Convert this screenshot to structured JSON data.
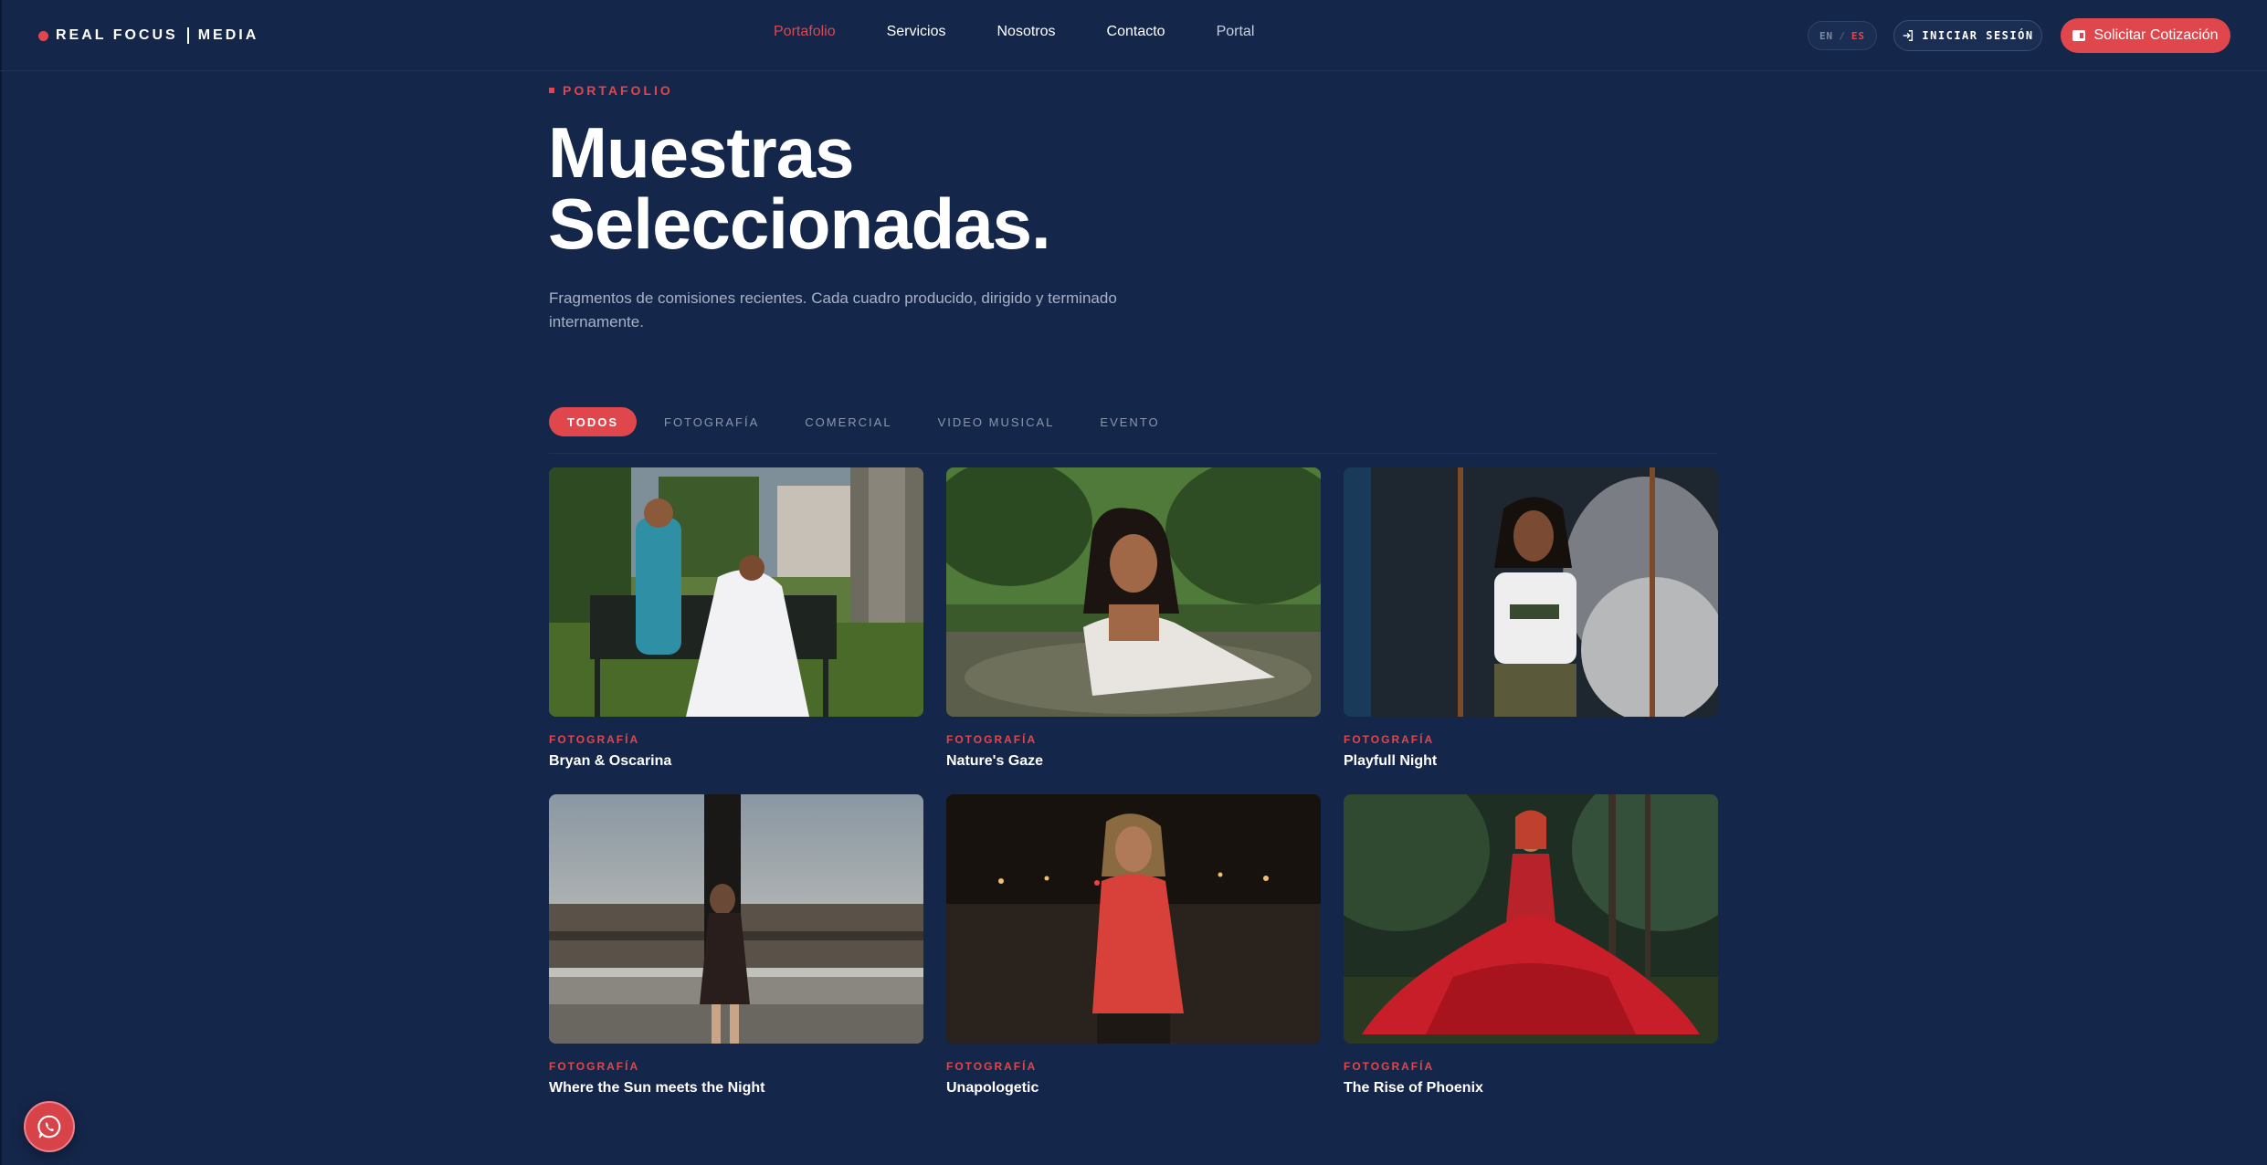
{
  "brand": {
    "name_left": "REAL FOCUS",
    "name_right": "MEDIA",
    "accent": "#e0474c",
    "background": "#14264a"
  },
  "nav": {
    "items": [
      {
        "label": "Portafolio",
        "state": "active"
      },
      {
        "label": "Servicios",
        "state": "default"
      },
      {
        "label": "Nosotros",
        "state": "default"
      },
      {
        "label": "Contacto",
        "state": "default"
      },
      {
        "label": "Portal",
        "state": "muted"
      }
    ],
    "lang": {
      "en": "EN",
      "sep": "/",
      "es": "ES",
      "selected": "ES"
    },
    "login_label": "INICIAR SESIÓN",
    "quote_label": "Solicitar Cotización"
  },
  "hero": {
    "eyebrow": "PORTAFOLIO",
    "title_line1": "Muestras",
    "title_line2": "Seleccionadas.",
    "subtitle": "Fragmentos de comisiones recientes. Cada cuadro producido, dirigido y terminado internamente."
  },
  "filters": {
    "items": [
      "TODOS",
      "FOTOGRAFÍA",
      "COMERCIAL",
      "VIDEO MUSICAL",
      "EVENTO"
    ],
    "selected": "TODOS"
  },
  "portfolio": [
    {
      "category": "FOTOGRAFÍA",
      "title": "Bryan & Oscarina"
    },
    {
      "category": "FOTOGRAFÍA",
      "title": "Nature's Gaze"
    },
    {
      "category": "FOTOGRAFÍA",
      "title": "Playfull Night"
    },
    {
      "category": "FOTOGRAFÍA",
      "title": "Where the Sun meets the Night"
    },
    {
      "category": "FOTOGRAFÍA",
      "title": "Unapologetic"
    },
    {
      "category": "FOTOGRAFÍA",
      "title": "The Rise of Phoenix"
    }
  ],
  "icons": {
    "login": "login-icon",
    "quote": "quote-icon",
    "whatsapp": "whatsapp-icon"
  }
}
